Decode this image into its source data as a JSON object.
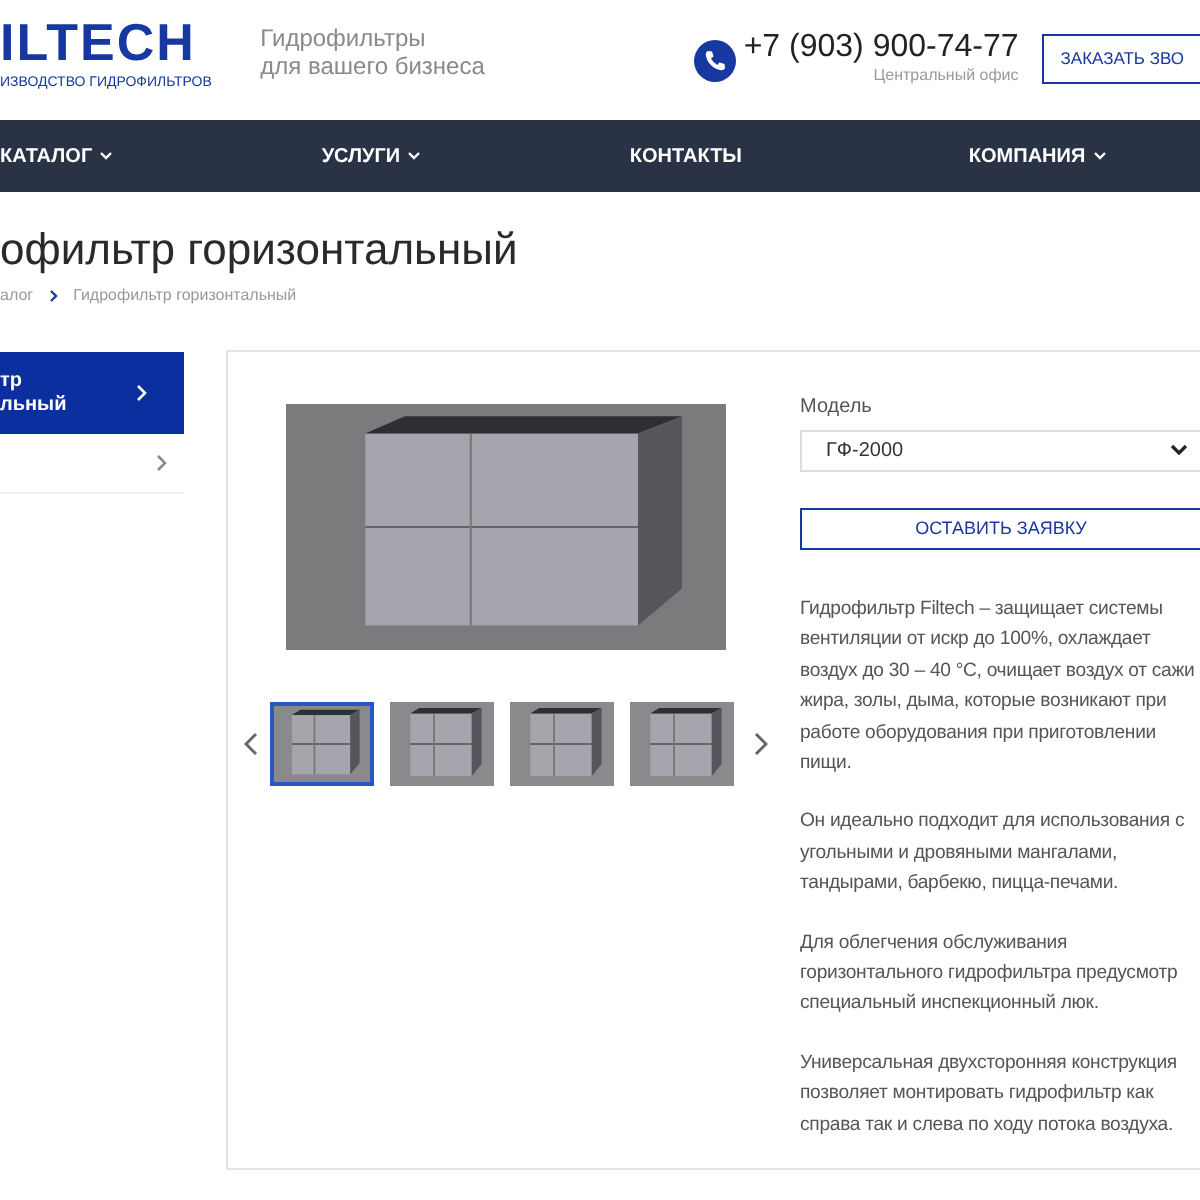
{
  "header": {
    "logo": "ILTECH",
    "logo_subtitle": "ИЗВОДСТВО ГИДРОФИЛЬТРОВ",
    "tagline": [
      "Гидрофильтры",
      "для вашего бизнеса"
    ],
    "phone": "+7 (903) 900-74-77",
    "phone_caption": "Центральный офис",
    "callback_button": "ЗАКАЗАТЬ ЗВО"
  },
  "nav": [
    {
      "label": "КАТАЛОГ",
      "dropdown": true
    },
    {
      "label": "УСЛУГИ",
      "dropdown": true
    },
    {
      "label": "КОНТАКТЫ",
      "dropdown": false
    },
    {
      "label": "КОМПАНИЯ",
      "dropdown": true
    }
  ],
  "page_title": "офильтр горизонтальный",
  "breadcrumbs": [
    "алог",
    "Гидрофильтр горизонтальный"
  ],
  "sidebar": [
    {
      "label": [
        "тр",
        "льный"
      ],
      "selected": true
    },
    {
      "selected": false
    }
  ],
  "gallery": {
    "thumbnails": [
      {
        "selected": true
      },
      {
        "selected": false
      },
      {
        "selected": false
      },
      {
        "selected": false
      }
    ]
  },
  "order_form": {
    "model_label": "Модель",
    "model_value": "ГФ-2000",
    "submit_button": "ОСТАВИТЬ ЗАЯВКУ"
  },
  "description": [
    [
      "Гидрофильтр Filtech – защищает системы",
      "вентиляции от искр до 100%, охлаждает",
      "воздух до 30 – 40 °С, очищает воздух от сажи",
      "жира, золы, дыма, которые возникают при",
      "работе оборудования при приготовлении",
      "пищи."
    ],
    [
      "Он идеально подходит для использования с",
      "угольными и дровяными мангалами,",
      "тандырами, барбекю, пицца-печами."
    ],
    [
      "Для облегчения обслуживания",
      "горизонтального гидрофильтра предусмотр",
      "специальный инспекционный люк."
    ],
    [
      "Универсальная двухсторонняя конструкция",
      "позволяет монтировать гидрофильтр как",
      "справа так и слева по ходу потока воздуха."
    ]
  ]
}
